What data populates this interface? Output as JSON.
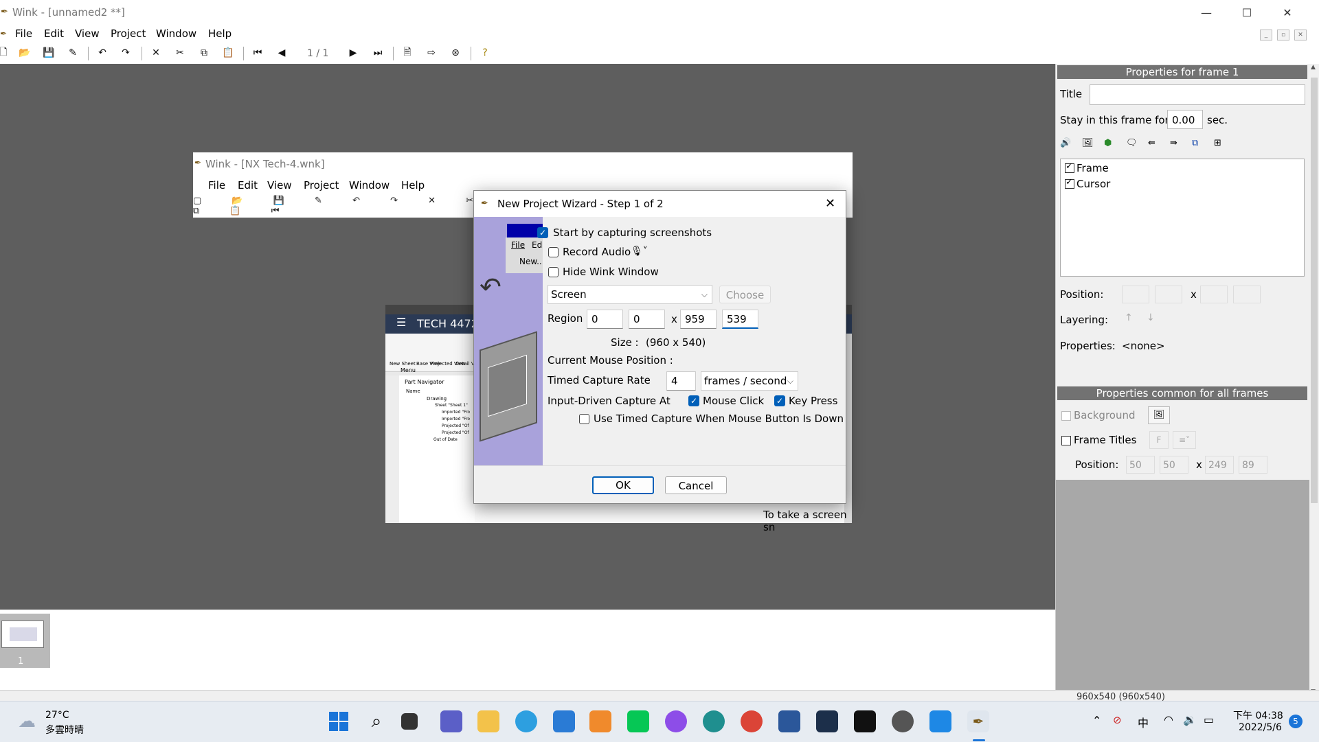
{
  "window": {
    "title": "Wink - [unnamed2 **]"
  },
  "menu": [
    "File",
    "Edit",
    "View",
    "Project",
    "Window",
    "Help"
  ],
  "toolbar": {
    "frame_counter": "1 / 1"
  },
  "inner_window": {
    "title": "Wink - [NX Tech-4.wnk]",
    "menu": [
      "File",
      "Edit",
      "View",
      "Project",
      "Window",
      "Help"
    ],
    "preview_heading": "TECH 4472",
    "preview_caption": "To take a screen sn",
    "nav_items": [
      "Part Navigator",
      "Name",
      "Drawing",
      "Sheet \"Sheet 1\"",
      "Imported \"Fro",
      "Imported \"Fro",
      "Projected \"Of",
      "Projected \"Of",
      "Out of Date"
    ],
    "ribbon": [
      "New Sheet",
      "Base View",
      "Projected View",
      "Detail View"
    ],
    "menu_btn": "Menu"
  },
  "dialog": {
    "title": "New Project Wizard - Step 1 of 2",
    "start_capture": "Start by capturing screenshots",
    "start_capture_checked": true,
    "record_audio": "Record Audio",
    "record_audio_checked": false,
    "hide_window": "Hide Wink Window",
    "hide_window_checked": false,
    "source_select": "Screen",
    "choose_btn": "Choose",
    "region_label": "Region :",
    "region": [
      "0",
      "0",
      "959",
      "539"
    ],
    "region_x": "x",
    "size_label": "Size :",
    "size_value": "(960 x 540)",
    "mouse_pos_label": "Current Mouse Position :",
    "rate_label": "Timed Capture Rate",
    "rate_value": "4",
    "rate_unit": "frames / second",
    "input_capture_label": "Input-Driven Capture At",
    "mouse_click": "Mouse Click",
    "mouse_click_checked": true,
    "key_press": "Key Press",
    "key_press_checked": true,
    "timed_when_down": "Use Timed Capture When Mouse Button Is Down",
    "timed_when_down_checked": false,
    "ok": "OK",
    "cancel": "Cancel",
    "side_menu": [
      "File",
      "Edit",
      "New..."
    ]
  },
  "props": {
    "header": "Properties for frame 1",
    "title_label": "Title",
    "title_value": "",
    "stay_label": "Stay in this frame for",
    "stay_value": "0.00",
    "stay_unit": "sec.",
    "items": [
      {
        "label": "Frame",
        "checked": true
      },
      {
        "label": "Cursor",
        "checked": true
      }
    ],
    "position_label": "Position:",
    "position_x": "x",
    "layering_label": "Layering:",
    "properties_label": "Properties:",
    "properties_value": "<none>"
  },
  "common": {
    "header": "Properties common for all frames",
    "background_label": "Background",
    "frame_titles_label": "Frame Titles",
    "position_label": "Position:",
    "position": [
      "50",
      "50",
      "249",
      "89"
    ],
    "position_x": "x"
  },
  "filmstrip": {
    "frame_label": "1"
  },
  "status": {
    "text": "960x540 (960x540)"
  },
  "taskbar": {
    "weather_temp": "27°C",
    "weather_desc": "多雲時晴",
    "time": "下午 04:38",
    "date": "2022/5/6",
    "ime": "中",
    "notifications": "5"
  }
}
